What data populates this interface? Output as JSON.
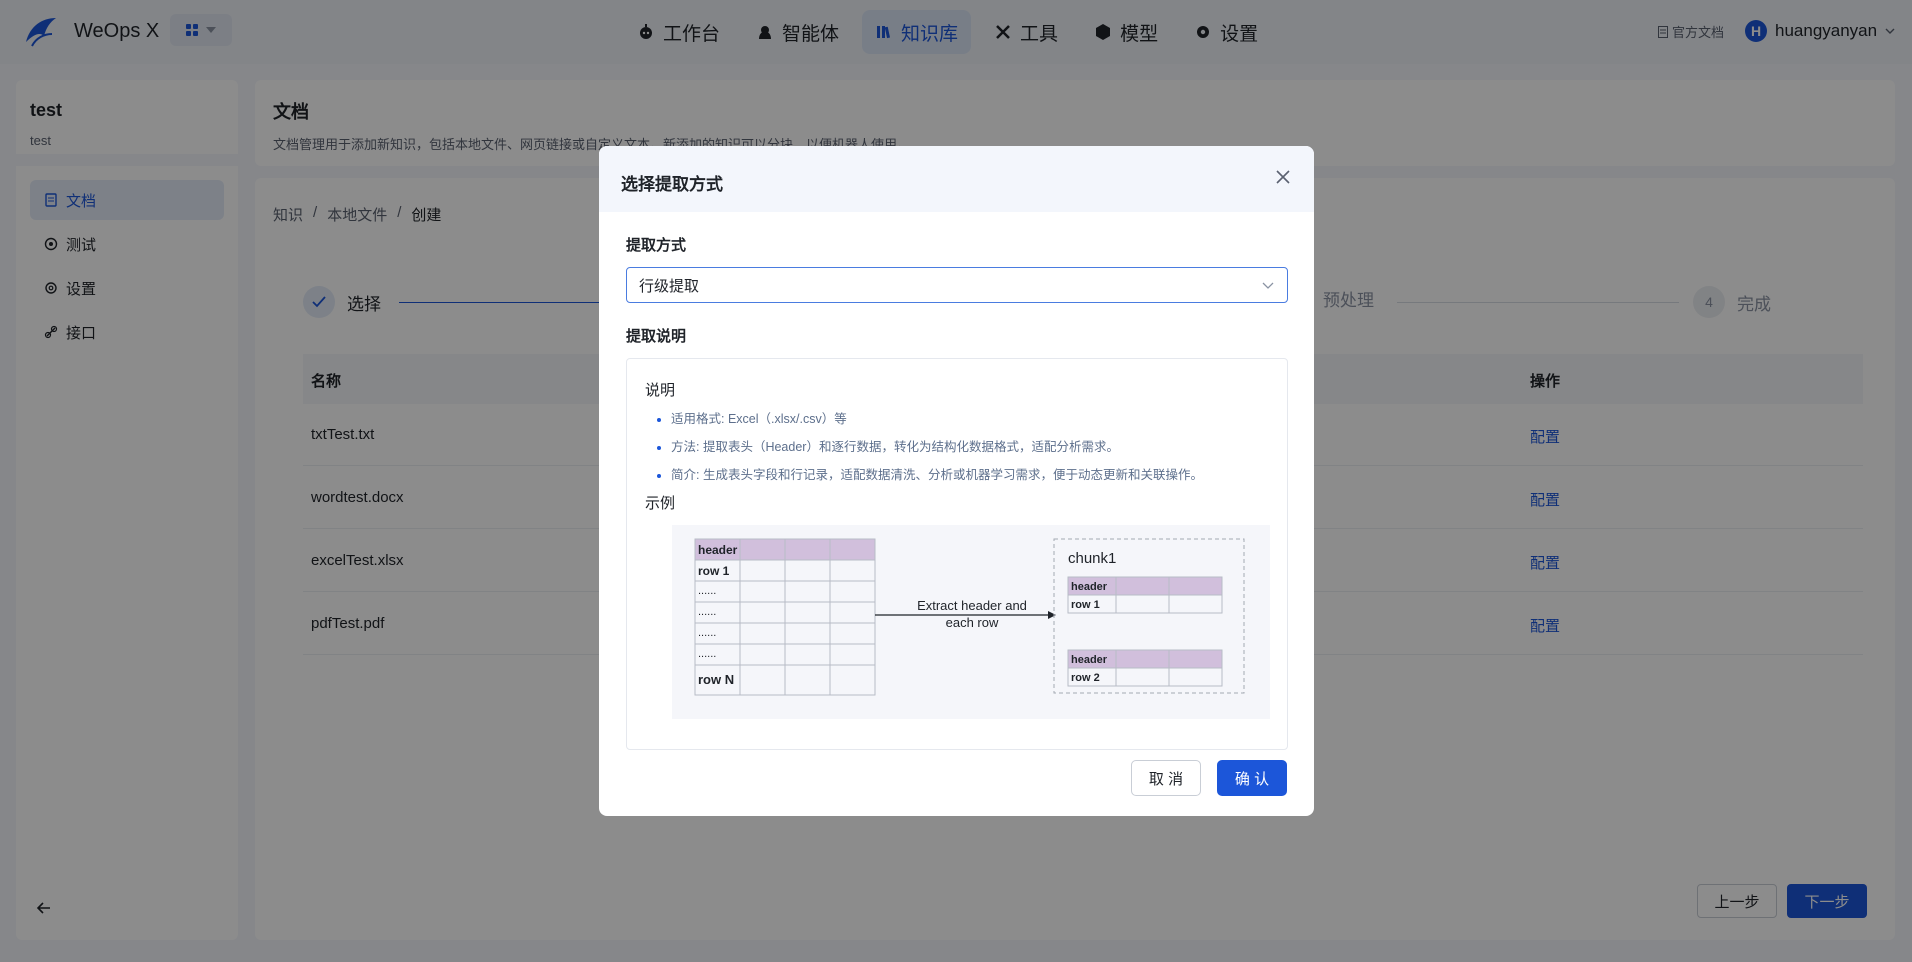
{
  "app": {
    "brand": "WeOps X",
    "nav": [
      "工作台",
      "智能体",
      "知识库",
      "工具",
      "模型",
      "设置"
    ],
    "doc_link": "官方文档",
    "user_name": "huangyanyan",
    "avatar_letter": "H"
  },
  "sidebar": {
    "kb_name": "test",
    "kb_desc": "test",
    "items": [
      "文档",
      "测试",
      "设置",
      "接口"
    ]
  },
  "main": {
    "title": "文档",
    "desc": "文档管理用于添加新知识，包括本地文件、网页链接或自定义文本。新添加的知识可以分块，以便机器人使用。",
    "breadcrumb": [
      "知识",
      "本地文件",
      "创建"
    ],
    "steps": [
      {
        "label": "选择"
      },
      {
        "label": "预处理"
      },
      {
        "num": "4",
        "label": "完成"
      }
    ],
    "table": {
      "col_name": "名称",
      "col_op": "操作",
      "rows": [
        {
          "name": "txtTest.txt",
          "op": "配置"
        },
        {
          "name": "wordtest.docx",
          "op": "配置"
        },
        {
          "name": "excelTest.xlsx",
          "op": "配置"
        },
        {
          "name": "pdfTest.pdf",
          "op": "配置"
        }
      ]
    },
    "prev": "上一步",
    "next": "下一步"
  },
  "modal": {
    "title": "选择提取方式",
    "method_label": "提取方式",
    "method_value": "行级提取",
    "desc_label": "提取说明",
    "desc_title": "说明",
    "bullets": [
      "适用格式: Excel（.xlsx/.csv）等",
      "方法: 提取表头（Header）和逐行数据，转化为结构化数据格式，适配分析需求。",
      "简介: 生成表头字段和行记录，适配数据清洗、分析或机器学习需求，便于动态更新和关联操作。"
    ],
    "example_title": "示例",
    "figure": {
      "header": "header",
      "row1": "row 1",
      "dots": "......",
      "rowN": "row N",
      "arrow_line1": "Extract header and",
      "arrow_line2": "each row",
      "chunk": "chunk1",
      "row2": "row 2"
    },
    "cancel": "取 消",
    "ok": "确 认"
  },
  "colors": {
    "accent": "#1c56d9",
    "header_cell": "#d1bfdc"
  }
}
